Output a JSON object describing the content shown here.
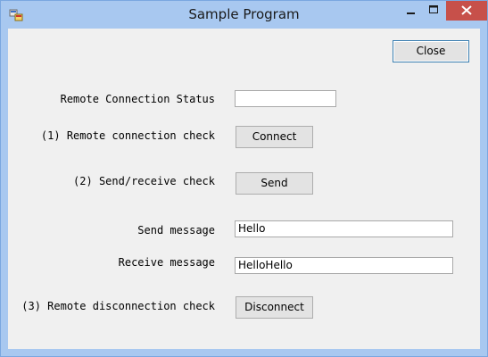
{
  "window": {
    "title": "Sample Program",
    "icon": "app-icon"
  },
  "title_bar_controls": {
    "minimize": "minimize-icon",
    "maximize": "maximize-icon",
    "close": "close-icon",
    "close_bg": "#c7504a"
  },
  "form": {
    "close_button": "Close",
    "status": {
      "label": "Remote Connection Status",
      "value": ""
    },
    "connect": {
      "label": "(1) Remote connection check",
      "button": "Connect"
    },
    "send_check": {
      "label": "(2) Send/receive check",
      "button": "Send"
    },
    "send_message": {
      "label": "Send message",
      "value": "Hello"
    },
    "receive_message": {
      "label": "Receive message",
      "value": "HelloHello"
    },
    "disconnect": {
      "label": "(3) Remote disconnection check",
      "button": "Disconnect"
    }
  }
}
